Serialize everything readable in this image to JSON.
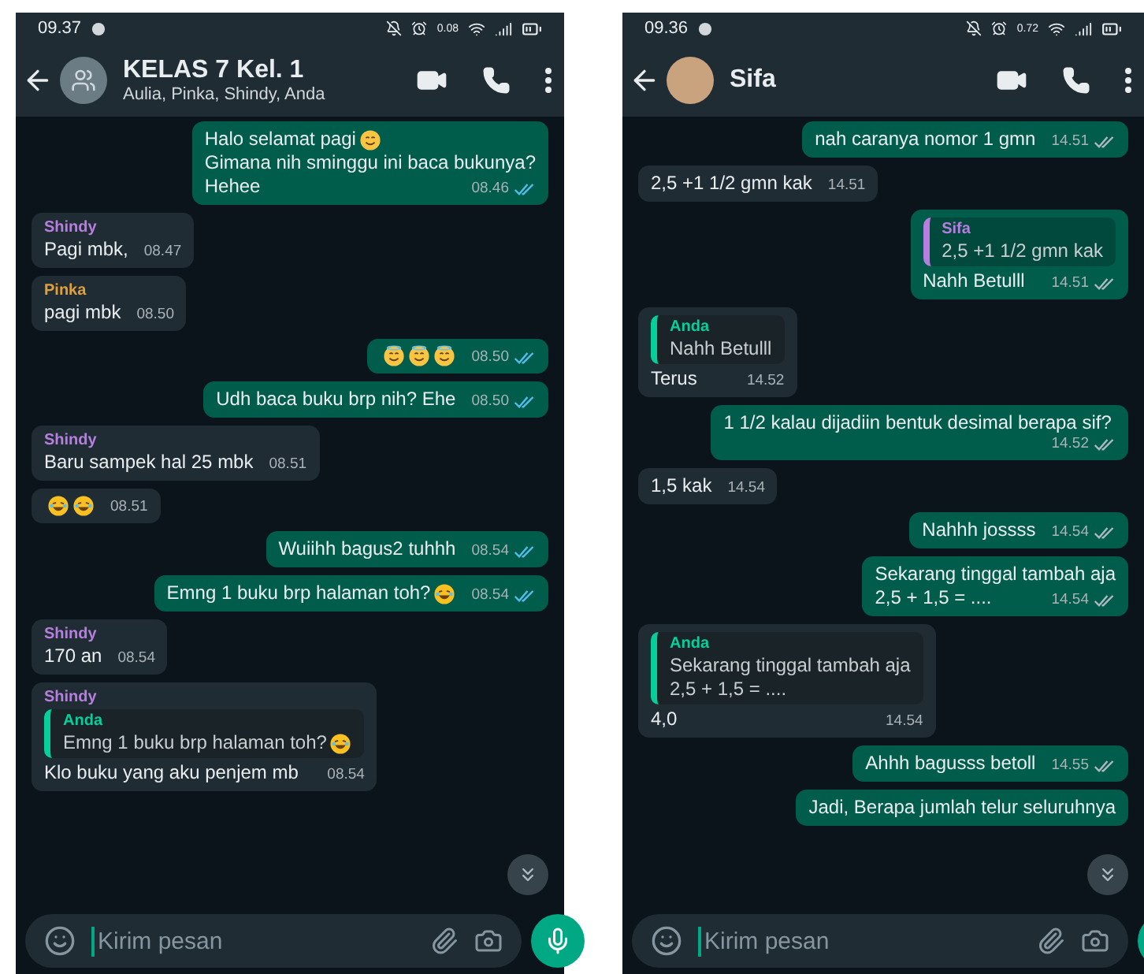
{
  "phones": [
    {
      "status": {
        "time": "09.37",
        "speed": "0.08"
      },
      "header": {
        "title": "KELAS 7 Kel. 1",
        "subtitle": "Aulia, Pinka, Shindy, Anda",
        "avatar": {
          "kind": "group"
        }
      },
      "messages": [
        {
          "kind": "out",
          "lines": [
            {
              "text": "Halo selamat pagi",
              "emoji": [
                {
                  "kind": "smile"
                }
              ]
            },
            {
              "text": "Gimana nih sminggu ini baca bukunya?"
            },
            {
              "text": "Hehee"
            }
          ],
          "time": "08.46",
          "read": true
        },
        {
          "kind": "in",
          "sender": {
            "name": "Shindy",
            "color": "#b77ee0"
          },
          "lines": [
            {
              "text": "Pagi mbk,"
            }
          ],
          "time": "08.47"
        },
        {
          "kind": "in",
          "sender": {
            "name": "Pinka",
            "color": "#e0a03a"
          },
          "lines": [
            {
              "text": "pagi mbk"
            }
          ],
          "time": "08.50"
        },
        {
          "kind": "out",
          "lines": [
            {
              "emoji": [
                {
                  "kind": "halo"
                },
                {
                  "kind": "halo"
                },
                {
                  "kind": "halo"
                }
              ]
            }
          ],
          "time": "08.50",
          "read": true
        },
        {
          "kind": "out",
          "lines": [
            {
              "text": "Udh baca buku brp nih? Ehe"
            }
          ],
          "time": "08.50",
          "read": true
        },
        {
          "kind": "in",
          "sender": {
            "name": "Shindy",
            "color": "#b77ee0"
          },
          "lines": [
            {
              "text": "Baru sampek hal 25 mbk"
            }
          ],
          "time": "08.51"
        },
        {
          "kind": "in",
          "lines": [
            {
              "emoji": [
                {
                  "kind": "laugh"
                },
                {
                  "kind": "laugh"
                }
              ]
            }
          ],
          "time": "08.51"
        },
        {
          "kind": "out",
          "lines": [
            {
              "text": "Wuiihh bagus2 tuhhh"
            }
          ],
          "time": "08.54",
          "read": true
        },
        {
          "kind": "out",
          "lines": [
            {
              "text": "Emng 1 buku brp halaman toh?",
              "emoji": [
                {
                  "kind": "laugh"
                }
              ]
            }
          ],
          "time": "08.54",
          "read": true
        },
        {
          "kind": "in",
          "sender": {
            "name": "Shindy",
            "color": "#b77ee0"
          },
          "lines": [
            {
              "text": "170 an"
            }
          ],
          "time": "08.54"
        },
        {
          "kind": "in",
          "sender": {
            "name": "Shindy",
            "color": "#b77ee0"
          },
          "quote": {
            "sender": "Anda",
            "color": "#06cf9c",
            "lines": [
              {
                "text": "Emng 1 buku brp halaman toh?",
                "emoji": [
                  {
                    "kind": "laugh"
                  }
                ]
              }
            ]
          },
          "lines": [
            {
              "text": "Klo buku yang aku penjem mb"
            }
          ],
          "time": "08.54"
        }
      ],
      "composer": {
        "placeholder": "Kirim pesan"
      }
    },
    {
      "status": {
        "time": "09.36",
        "speed": "0.72"
      },
      "header": {
        "title": "Sifa",
        "avatar": {
          "kind": "photo"
        }
      },
      "messages": [
        {
          "kind": "out",
          "lines": [
            {
              "text": "nah caranya nomor 1 gmn"
            }
          ],
          "time": "14.51",
          "read": false
        },
        {
          "kind": "in",
          "lines": [
            {
              "text": "2,5 +1 1/2 gmn kak"
            }
          ],
          "time": "14.51"
        },
        {
          "kind": "out",
          "quote": {
            "sender": "Sifa",
            "color": "#b77ee0",
            "lines": [
              {
                "text": "2,5 +1 1/2 gmn kak"
              }
            ]
          },
          "lines": [
            {
              "text": "Nahh Betulll"
            }
          ],
          "time": "14.51",
          "read": false
        },
        {
          "kind": "in",
          "quote": {
            "sender": "Anda",
            "color": "#06cf9c",
            "lines": [
              {
                "text": "Nahh Betulll"
              }
            ]
          },
          "lines": [
            {
              "text": "Terus"
            }
          ],
          "time": "14.52"
        },
        {
          "kind": "out",
          "lines": [
            {
              "text": "1 1/2 kalau dijadiin bentuk desimal berapa sif?"
            }
          ],
          "time": "14.52",
          "read": false
        },
        {
          "kind": "in",
          "lines": [
            {
              "text": "1,5 kak"
            }
          ],
          "time": "14.54"
        },
        {
          "kind": "out",
          "lines": [
            {
              "text": "Nahhh jossss"
            }
          ],
          "time": "14.54",
          "read": false
        },
        {
          "kind": "out",
          "lines": [
            {
              "text": "Sekarang tinggal tambah aja"
            },
            {
              "text": "2,5 + 1,5 = ...."
            }
          ],
          "time": "14.54",
          "read": false
        },
        {
          "kind": "in",
          "quote": {
            "sender": "Anda",
            "color": "#06cf9c",
            "lines": [
              {
                "text": "Sekarang tinggal tambah aja"
              },
              {
                "text": "2,5 + 1,5 = ...."
              }
            ]
          },
          "lines": [
            {
              "text": "4,0"
            }
          ],
          "time": "14.54"
        },
        {
          "kind": "out",
          "lines": [
            {
              "text": "Ahhh bagusss betoll"
            }
          ],
          "time": "14.55",
          "read": false
        },
        {
          "kind": "out",
          "lines": [
            {
              "text": "Jadi, Berapa jumlah telur seluruhnya"
            }
          ]
        }
      ],
      "composer": {
        "placeholder": "Kirim pesan"
      }
    }
  ]
}
